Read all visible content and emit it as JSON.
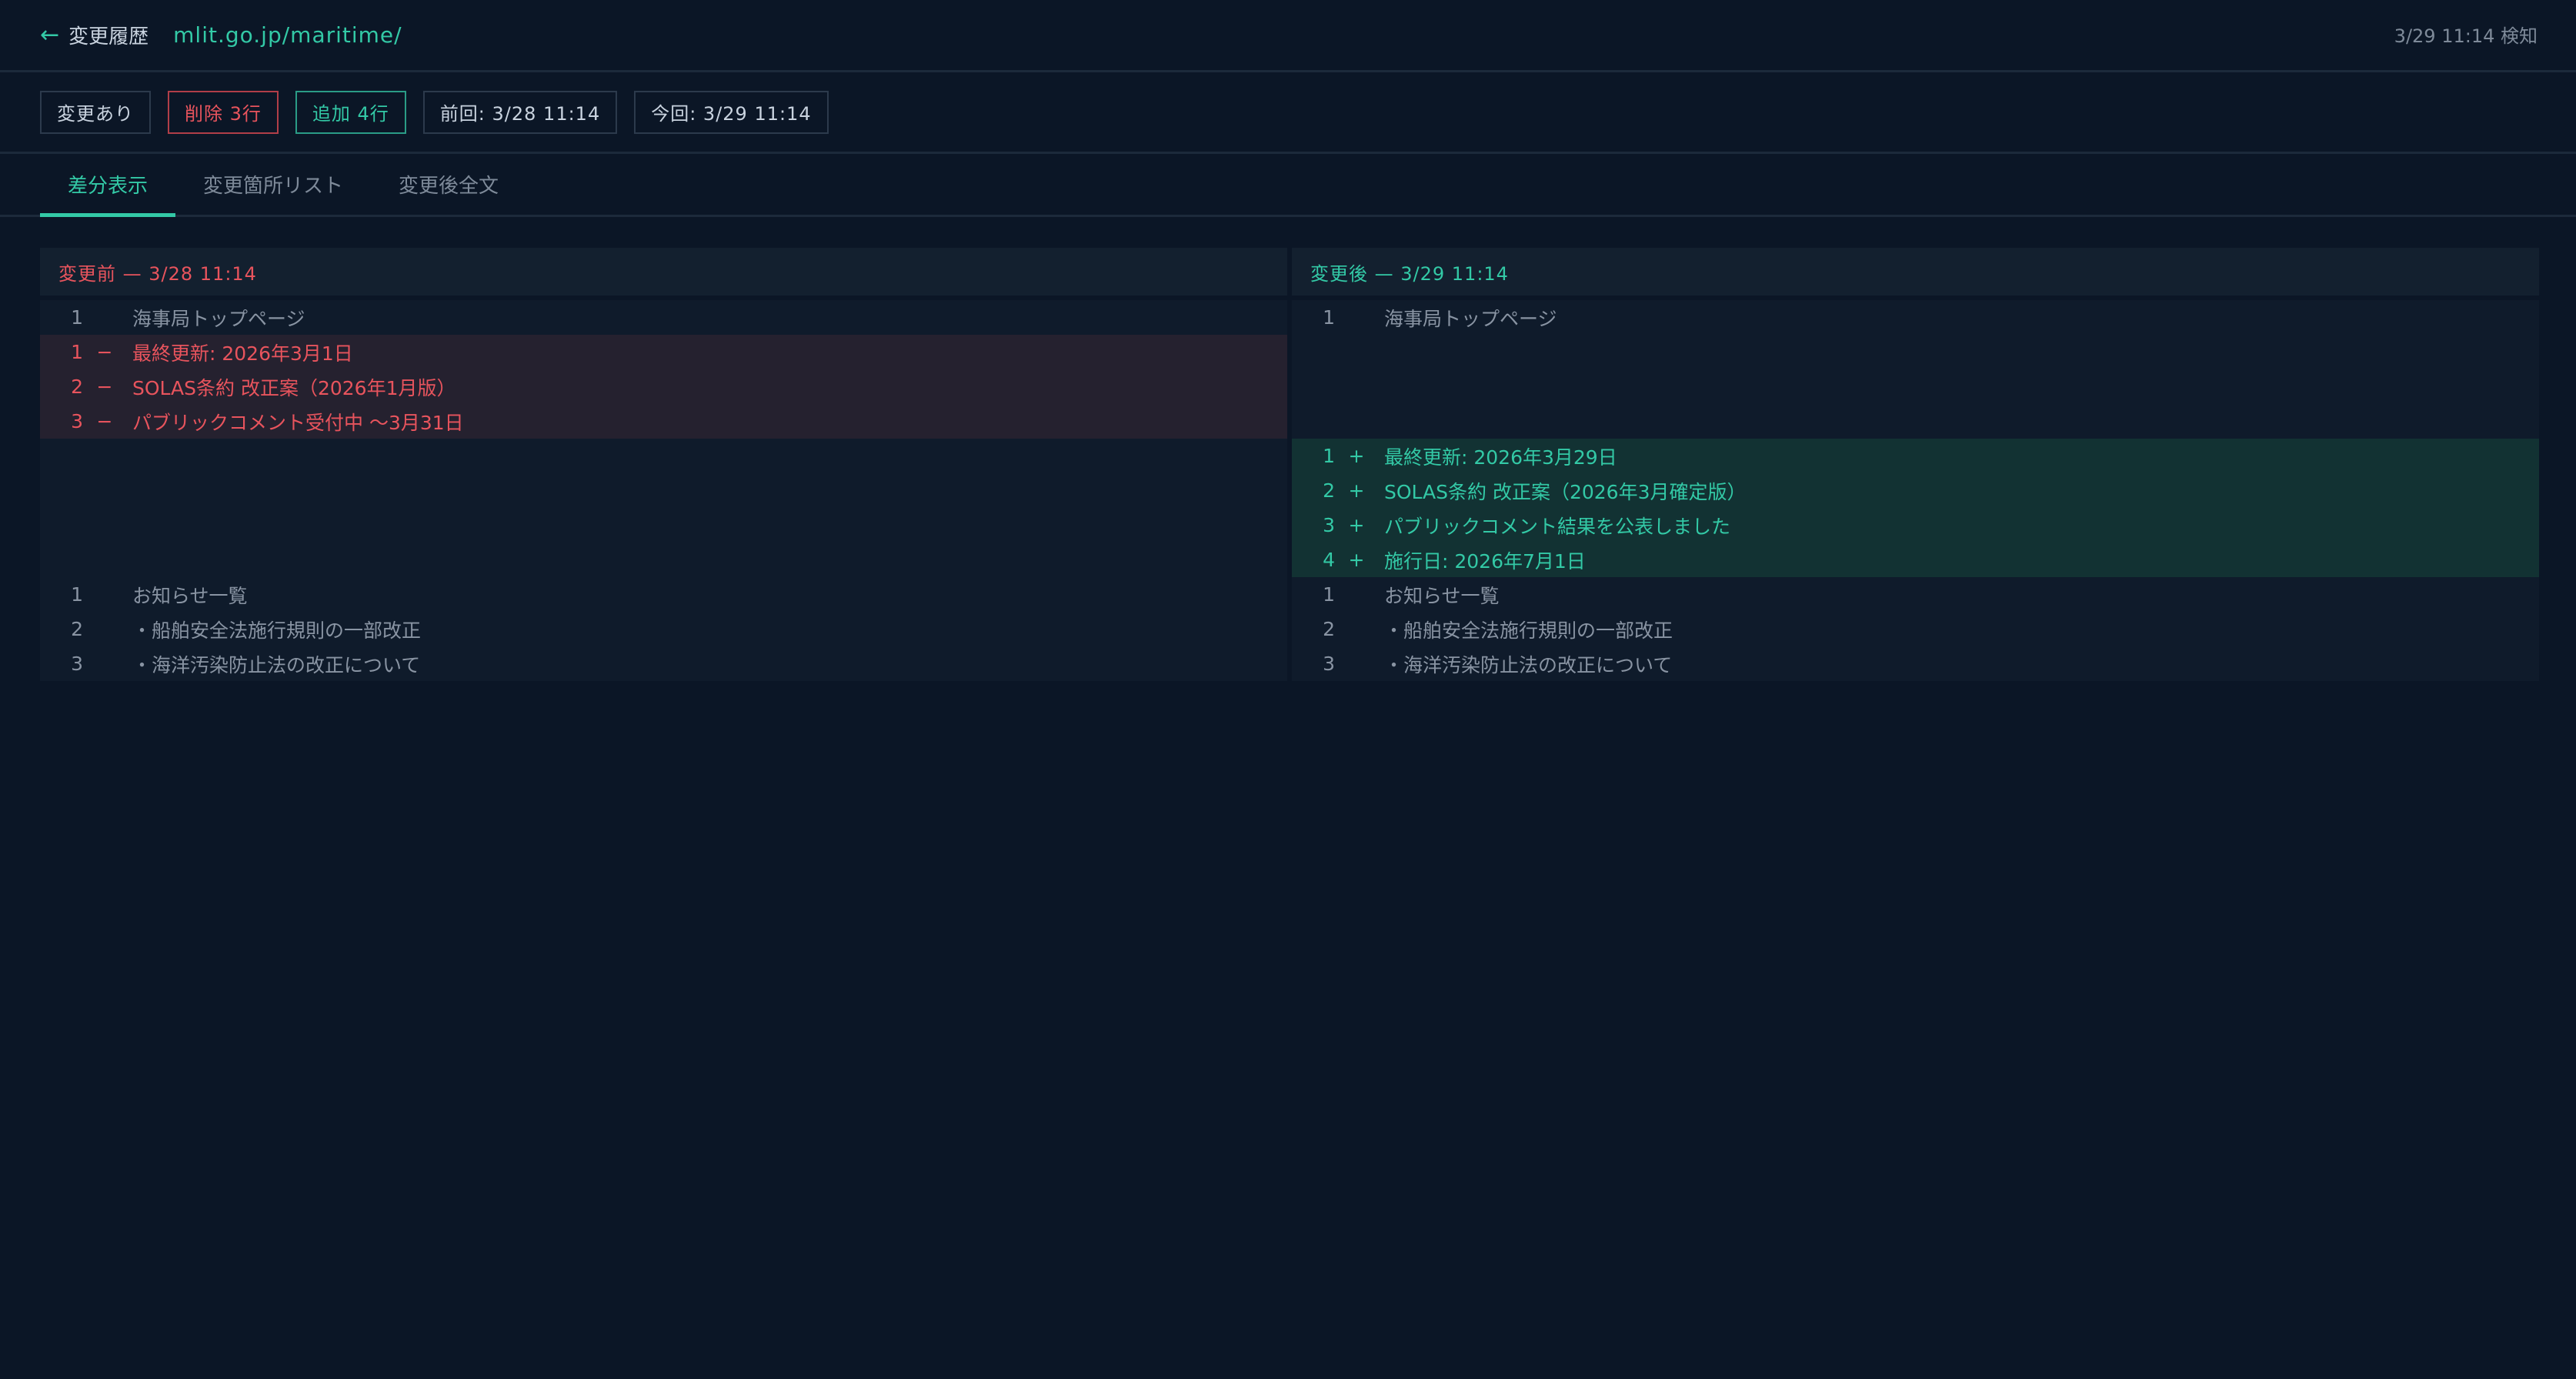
{
  "header": {
    "back_label": "変更履歴",
    "url": "mlit.go.jp/maritime/",
    "detected_at": "3/29 11:14 検知"
  },
  "badges": {
    "changed": "変更あり",
    "removed": "削除 3行",
    "added": "追加 4行",
    "previous": "前回: 3/28 11:14",
    "current": "今回: 3/29 11:14"
  },
  "tabs": [
    "差分表示",
    "変更箇所リスト",
    "変更後全文"
  ],
  "diff": {
    "before_title": "変更前 — 3/28 11:14",
    "after_title": "変更後 — 3/29 11:14",
    "before_lines": [
      {
        "num": "1",
        "mark": "",
        "text": "海事局トップページ",
        "kind": "ctx"
      },
      {
        "num": "1",
        "mark": "−",
        "text": "最終更新: 2026年3月1日",
        "kind": "del"
      },
      {
        "num": "2",
        "mark": "−",
        "text": "SOLAS条約 改正案（2026年1月版）",
        "kind": "del"
      },
      {
        "num": "3",
        "mark": "−",
        "text": "パブリックコメント受付中 〜3月31日",
        "kind": "del"
      },
      {
        "num": "",
        "mark": "",
        "text": "",
        "kind": "blank"
      },
      {
        "num": "",
        "mark": "",
        "text": "",
        "kind": "blank"
      },
      {
        "num": "",
        "mark": "",
        "text": "",
        "kind": "blank"
      },
      {
        "num": "",
        "mark": "",
        "text": "",
        "kind": "blank"
      },
      {
        "num": "1",
        "mark": "",
        "text": "お知らせ一覧",
        "kind": "ctx"
      },
      {
        "num": "2",
        "mark": "",
        "text": "・船舶安全法施行規則の一部改正",
        "kind": "ctx"
      },
      {
        "num": "3",
        "mark": "",
        "text": "・海洋汚染防止法の改正について",
        "kind": "ctx"
      }
    ],
    "after_lines": [
      {
        "num": "1",
        "mark": "",
        "text": "海事局トップページ",
        "kind": "ctx"
      },
      {
        "num": "",
        "mark": "",
        "text": "",
        "kind": "blank"
      },
      {
        "num": "",
        "mark": "",
        "text": "",
        "kind": "blank"
      },
      {
        "num": "",
        "mark": "",
        "text": "",
        "kind": "blank"
      },
      {
        "num": "1",
        "mark": "+",
        "text": "最終更新: 2026年3月29日",
        "kind": "add"
      },
      {
        "num": "2",
        "mark": "+",
        "text": "SOLAS条約 改正案（2026年3月確定版）",
        "kind": "add"
      },
      {
        "num": "3",
        "mark": "+",
        "text": "パブリックコメント結果を公表しました",
        "kind": "add"
      },
      {
        "num": "4",
        "mark": "+",
        "text": "施行日: 2026年7月1日",
        "kind": "add"
      },
      {
        "num": "1",
        "mark": "",
        "text": "お知らせ一覧",
        "kind": "ctx"
      },
      {
        "num": "2",
        "mark": "",
        "text": "・船舶安全法施行規則の一部改正",
        "kind": "ctx"
      },
      {
        "num": "3",
        "mark": "",
        "text": "・海洋汚染防止法の改正について",
        "kind": "ctx"
      }
    ]
  }
}
